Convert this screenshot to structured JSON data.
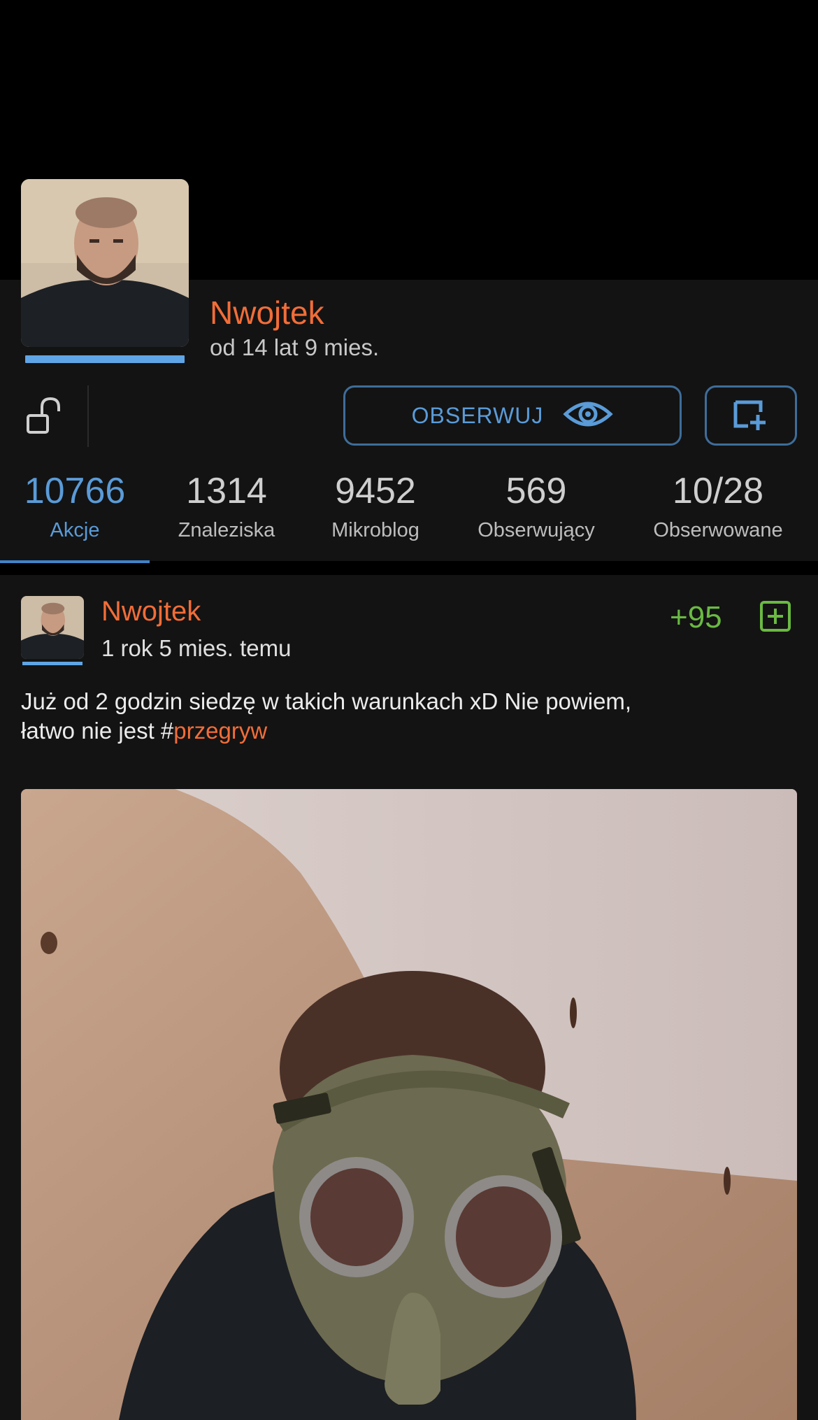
{
  "profile": {
    "username": "Nwojtek",
    "member_since": "od 14 lat 9 mies.",
    "follow_label": "OBSERWUJ"
  },
  "stats": [
    {
      "value": "10766",
      "label": "Akcje",
      "active": true
    },
    {
      "value": "1314",
      "label": "Znaleziska",
      "active": false
    },
    {
      "value": "9452",
      "label": "Mikroblog",
      "active": false
    },
    {
      "value": "569",
      "label": "Obserwujący",
      "active": false
    },
    {
      "value": "10/28",
      "label": "Obserwowane",
      "active": false
    }
  ],
  "entry": {
    "author": "Nwojtek",
    "time": "1 rok 5 mies. temu",
    "score": "+95",
    "text": "Już od 2 godzin siedzę w takich warunkach xD Nie powiem,",
    "text_line2": "łatwo nie jest #",
    "hashtag": "przegryw"
  },
  "icons": {
    "lock": "unlock-icon",
    "eye": "eye-icon",
    "add": "add-to-list-icon",
    "vote": "plus-square-icon"
  },
  "colors": {
    "accent_orange": "#f26d38",
    "accent_blue": "#5a9bd8",
    "score_green": "#6ab943",
    "panel_bg": "#131313"
  }
}
